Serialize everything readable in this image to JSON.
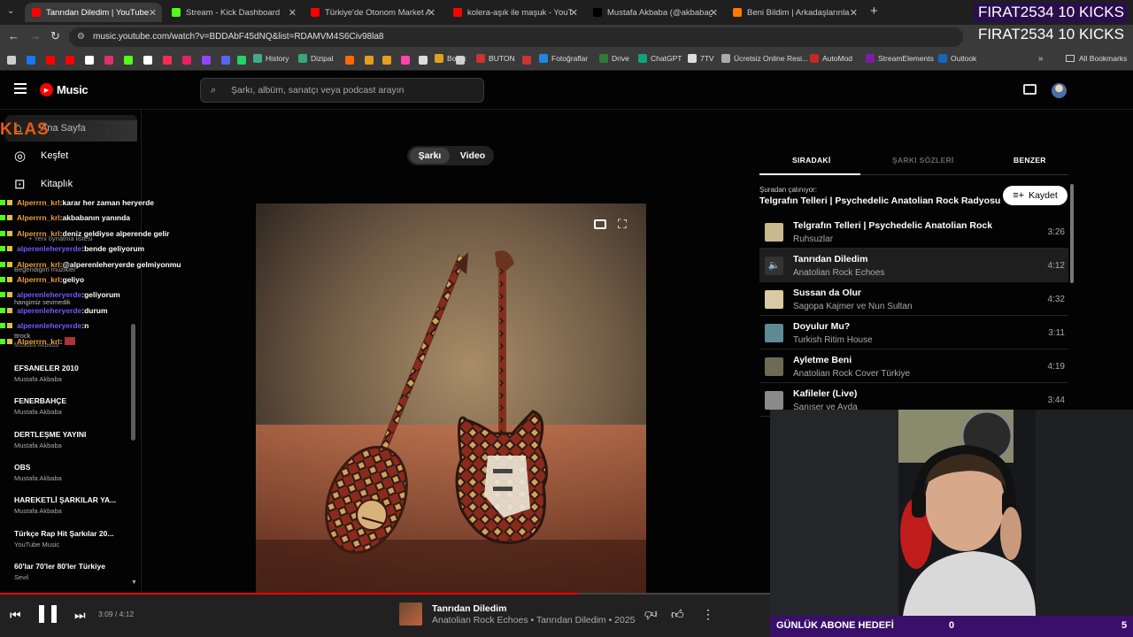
{
  "browser": {
    "tabs": [
      {
        "label": "Tanrıdan Diledim | YouTube",
        "color": "#ff0000"
      },
      {
        "label": "Stream - Kick Dashboard",
        "color": "#53fc18"
      },
      {
        "label": "Türkiye'de Otonom Market Alış",
        "color": "#ff0000"
      },
      {
        "label": "kolera-aşık ile maşuk - YouTube",
        "color": "#ff0000"
      },
      {
        "label": "Mustafa Akbaba (@akbabagran",
        "color": "#000000"
      },
      {
        "label": "Beni Bildim | Arkadaşlarınla Onl",
        "color": "#ff7a00"
      }
    ],
    "url": "music.youtube.com/watch?v=BDDAbF45dNQ&list=RDAMVM4S6Civ98la8",
    "bookmarks": [
      "History",
      "Dizipal",
      "Botrix",
      "BUTON",
      "Fotoğraflar",
      "Drive",
      "ChatGPT",
      "7TV",
      "Ücretsiz Online Resi...",
      "AutoMod",
      "StreamElements",
      "Outlook"
    ],
    "all_bookmarks": "All Bookmarks"
  },
  "header": {
    "logo": "Music",
    "search_placeholder": "Şarkı, albüm, sanatçı veya podcast arayın"
  },
  "sidebar": {
    "nav": [
      {
        "label": "Ana Sayfa",
        "icon": "home-icon"
      },
      {
        "label": "Keşfet",
        "icon": "compass-icon"
      },
      {
        "label": "Kitaplık",
        "icon": "library-icon"
      }
    ],
    "new_playlist": "+ Yeni oynatma listesi",
    "faded": [
      "Beğendiğim müzikler",
      "hangimiz sevmedik",
      "ttrock",
      "Mustafa Akbaba"
    ],
    "playlists": [
      {
        "title": "EFSANELER 2010",
        "sub": "Mustafa Akbaba"
      },
      {
        "title": "FENERBAHÇE",
        "sub": "Mustafa Akbaba"
      },
      {
        "title": "DERTLEŞME YAYINI",
        "sub": "Mustafa Akbaba"
      },
      {
        "title": "OBS",
        "sub": "Mustafa Akbaba"
      },
      {
        "title": "HAREKETLİ ŞARKILAR YA...",
        "sub": "Mustafa Akbaba"
      },
      {
        "title": "Türkçe Rap Hit Şarkılar 20...",
        "sub": "YouTube Music"
      },
      {
        "title": "60'lar 70'ler 80'ler Türkiye",
        "sub": "Sevil"
      }
    ]
  },
  "main": {
    "toggle": {
      "song": "Şarkı",
      "video": "Video"
    }
  },
  "queue": {
    "tabs": [
      "SIRADAKİ",
      "ŞARKI SÖZLERİ",
      "BENZER"
    ],
    "playing_from_label": "Şuradan çalınıyor:",
    "playing_from": "Telgrafın Telleri | Psychedelic Anatolian Rock Radyosu",
    "save_label": "Kaydet",
    "items": [
      {
        "title": "Telgrafın Telleri | Psychedelic Anatolian Rock",
        "artist": "Ruhsuzlar",
        "duration": "3:26",
        "thumb": "#c9b98f"
      },
      {
        "title": "Tanrıdan Diledim",
        "artist": "Anatolian Rock Echoes",
        "duration": "4:12",
        "thumb": "#333333",
        "playing": true
      },
      {
        "title": "Sussan da Olur",
        "artist": "Sagopa Kajmer ve Nun Sultan",
        "duration": "4:32",
        "thumb": "#d9c9a5"
      },
      {
        "title": "Doyulur Mu?",
        "artist": "Turkish Ritim House",
        "duration": "3:11",
        "thumb": "#5d8a93"
      },
      {
        "title": "Ayletme Beni",
        "artist": "Anatolian Rock Cover Türkiye",
        "duration": "4:19",
        "thumb": "#6f6a55"
      },
      {
        "title": "Kafileler (Live)",
        "artist": "Sanışer ve Ayda",
        "duration": "3:44",
        "thumb": "#8a8a8a"
      }
    ]
  },
  "player": {
    "time": "3:09 / 4:12",
    "progress": 0.75,
    "title": "Tanrıdan Diledim",
    "subtitle": "Anatolian Rock Echoes • Tanrıdan Diledim • 2025"
  },
  "overlay": {
    "kicks": "FIRAT2534  10 KICKS",
    "kicks_echo": "FIRAT2534  10 KICKS",
    "klas": "KLAS",
    "chat": [
      {
        "user": "Alperrrn_krl",
        "msg": "karar her zaman heryerde",
        "color": "#f0a030"
      },
      {
        "user": "Alperrrn_krl",
        "msg": "akbabanın yanında",
        "color": "#f0a030"
      },
      {
        "user": "Alperrrn_krl",
        "msg": "deniz geldiyse alperende gelir",
        "color": "#f0a030"
      },
      {
        "user": "alperenleheryerde",
        "msg": "bende geliyorum",
        "color": "#6f5cff"
      },
      {
        "user": "Alperrrn_krl",
        "msg": "@alperenleheryerde gelmiyonmu",
        "color": "#f0a030"
      },
      {
        "user": "Alperrrn_krl",
        "msg": "geliyo",
        "color": "#f0a030"
      },
      {
        "user": "alperenleheryerde",
        "msg": "geliyorum",
        "color": "#6f5cff"
      },
      {
        "user": "alperenleheryerde",
        "msg": "durum",
        "color": "#6f5cff"
      },
      {
        "user": "alperenleheryerde",
        "msg": "n",
        "color": "#6f5cff"
      },
      {
        "user": "Alperrrn_krl",
        "msg": "",
        "color": "#f0a030"
      }
    ],
    "goal_label": "GÜNLÜK ABONE HEDEFİ",
    "goal_current": "0",
    "goal_target": "5"
  }
}
